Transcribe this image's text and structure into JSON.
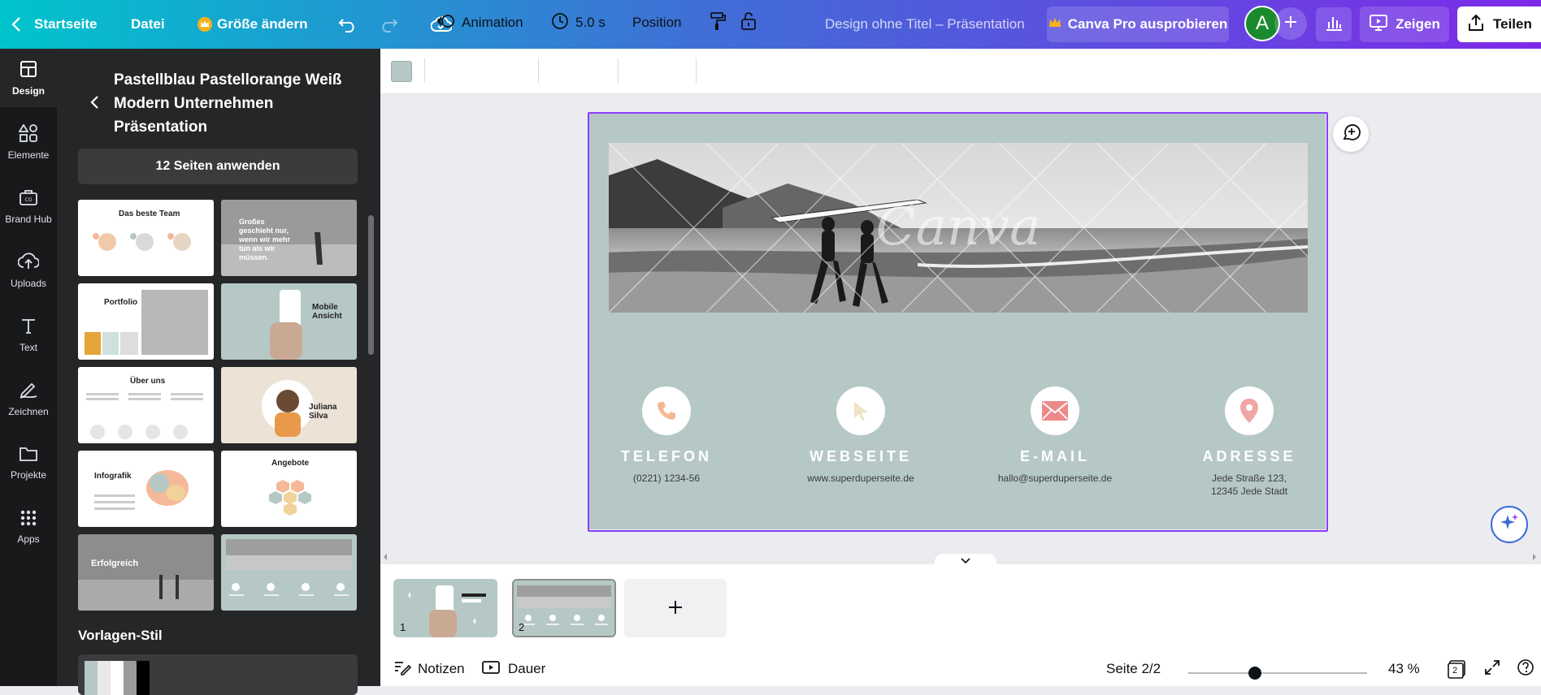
{
  "topbar": {
    "home": "Startseite",
    "file": "Datei",
    "resize": "Größe ändern",
    "doc_title": "Design ohne Titel – Präsentation",
    "pro": "Canva Pro ausprobieren",
    "avatar_letter": "A",
    "present": "Zeigen",
    "share": "Teilen"
  },
  "rail": {
    "items": [
      {
        "label": "Design",
        "icon": "layout-icon"
      },
      {
        "label": "Elemente",
        "icon": "shapes-icon"
      },
      {
        "label": "Brand Hub",
        "icon": "brand-icon"
      },
      {
        "label": "Uploads",
        "icon": "upload-cloud-icon"
      },
      {
        "label": "Text",
        "icon": "text-icon"
      },
      {
        "label": "Zeichnen",
        "icon": "draw-icon"
      },
      {
        "label": "Projekte",
        "icon": "folder-icon"
      },
      {
        "label": "Apps",
        "icon": "apps-grid-icon"
      }
    ]
  },
  "panel": {
    "title": "Pastellblau Pastellorange Weiß Modern Unternehmen Präsentation",
    "apply": "12 Seiten anwenden",
    "thumbs": [
      {
        "label": "Das beste Team"
      },
      {
        "label": "Großes geschieht nur, wenn wir mehr tun als wir müssen."
      },
      {
        "label": "Portfolio"
      },
      {
        "label": "Mobile Ansicht"
      },
      {
        "label": "Über uns"
      },
      {
        "label": "Juliana Silva"
      },
      {
        "label": "Infografik"
      },
      {
        "label": "Angebote"
      },
      {
        "label": "Erfolgreich"
      },
      {
        "label": ""
      }
    ],
    "style_label": "Vorlagen-Stil"
  },
  "toolbar": {
    "color": "#b5c8c6",
    "animation": "Animation",
    "duration": "5.0 s",
    "position": "Position"
  },
  "slide": {
    "background": "#b5c8c6",
    "watermark": "Canva",
    "contacts": [
      {
        "title": "TELEFON",
        "value": "(0221) 1234-56",
        "icon": "phone-icon"
      },
      {
        "title": "WEBSEITE",
        "value": "www.superduperseite.de",
        "icon": "cursor-icon"
      },
      {
        "title": "E-MAIL",
        "value": "hallo@superduperseite.de",
        "icon": "mail-icon"
      },
      {
        "title": "ADRESSE",
        "value": "Jede Straße 123,\n12345 Jede Stadt",
        "icon": "location-pin-icon"
      }
    ]
  },
  "pages": [
    {
      "num": "1"
    },
    {
      "num": "2"
    }
  ],
  "footer": {
    "notes": "Notizen",
    "duration": "Dauer",
    "page_indicator": "Seite 2/2",
    "zoom": "43 %",
    "zoom_percent": 43,
    "page_count": "2"
  }
}
